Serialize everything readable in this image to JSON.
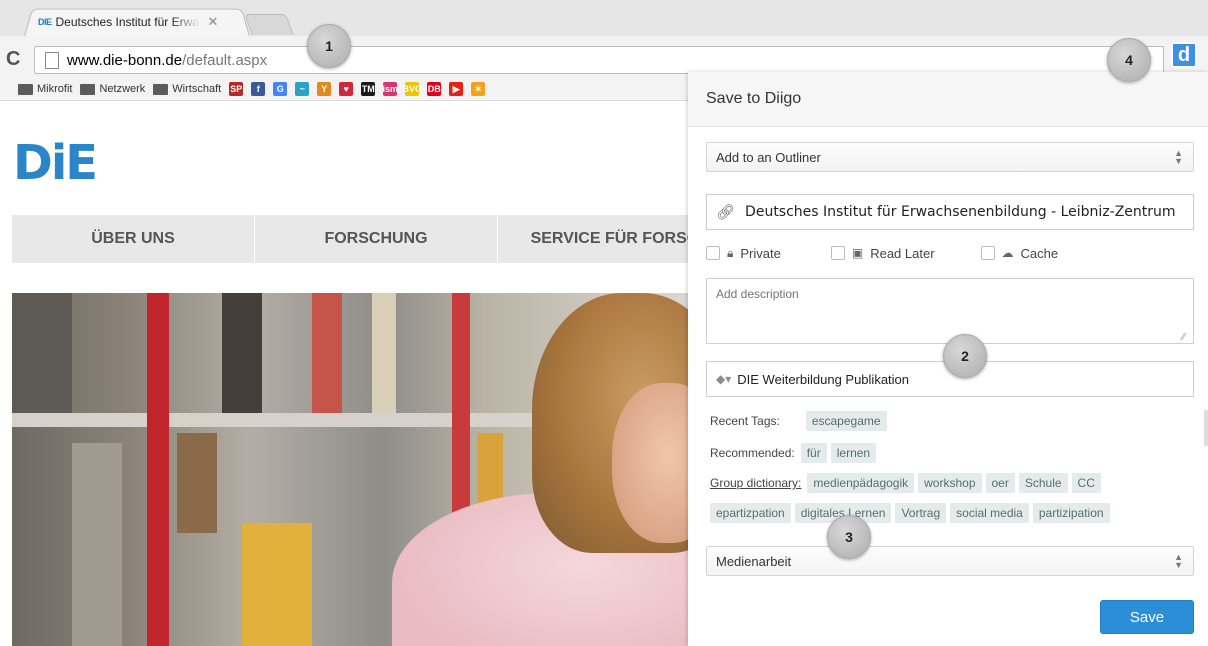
{
  "browser": {
    "tab_title": "Deutsches Institut für Erwa",
    "tab_favicon": "DIE",
    "url_host": "www.die-bonn.de",
    "url_path": "/default.aspx",
    "bookmarks": [
      {
        "label": "Mikrofit"
      },
      {
        "label": "Netzwerk"
      },
      {
        "label": "Wirtschaft"
      }
    ],
    "bookmark_icons": [
      {
        "text": "SP",
        "color": "#b12b2b"
      },
      {
        "text": "f",
        "color": "#3b5998"
      },
      {
        "text": "G",
        "color": "#4285f4"
      },
      {
        "text": "~",
        "color": "#2aa3c8"
      },
      {
        "text": "Y",
        "color": "#e08a1e"
      },
      {
        "text": "♥",
        "color": "#d0293a"
      },
      {
        "text": "TM",
        "color": "#1a1a1a"
      },
      {
        "text": "ism",
        "color": "#d53575"
      },
      {
        "text": "BVG",
        "color": "#f0c400"
      },
      {
        "text": "DB",
        "color": "#e2001a"
      },
      {
        "text": "▶",
        "color": "#e62117"
      },
      {
        "text": "✶",
        "color": "#f3a21c"
      }
    ]
  },
  "site": {
    "logo": "DiE",
    "nav": [
      "ÜBER UNS",
      "FORSCHUNG",
      "SERVICE FÜR FORSCHUNG"
    ]
  },
  "diigo": {
    "header": "Save to Diigo",
    "outliner_select": "Add to an Outliner",
    "title_value": "Deutsches Institut für Erwachsenenbildung - Leibniz-Zentrum",
    "options": {
      "private": "Private",
      "read_later": "Read Later",
      "cache": "Cache"
    },
    "description_placeholder": "Add description",
    "tags_value": "DIE Weiterbildung Publikation",
    "recent_tags_label": "Recent Tags:",
    "recent_tags": [
      "escapegame"
    ],
    "recommended_label": "Recommended:",
    "recommended_tags": [
      "für",
      "lernen"
    ],
    "group_dictionary_label": "Group dictionary:",
    "group_tags_row1": [
      "medienpädagogik",
      "workshop",
      "oer",
      "Schule",
      "CC"
    ],
    "group_tags_row2": [
      "epartizpation",
      "digitales Lernen",
      "Vortrag",
      "social media",
      "partizipation"
    ],
    "group_select": "Medienarbeit",
    "save_label": "Save"
  },
  "callouts": [
    "1",
    "2",
    "3",
    "4"
  ],
  "colors": {
    "accent": "#2b8ed7",
    "logo": "#2a86c8",
    "chip_bg": "#e4ebea"
  }
}
